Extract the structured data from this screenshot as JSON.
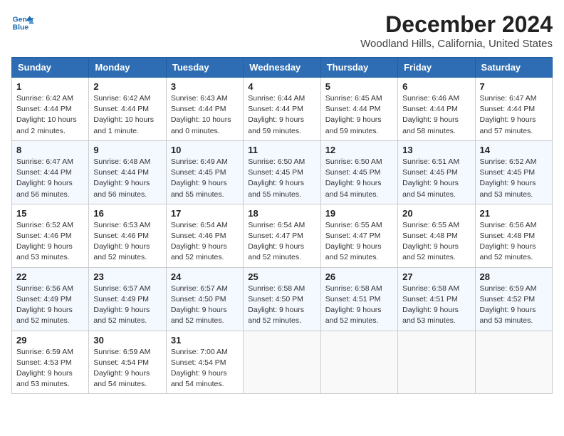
{
  "logo": {
    "line1": "General",
    "line2": "Blue"
  },
  "title": "December 2024",
  "subtitle": "Woodland Hills, California, United States",
  "days_of_week": [
    "Sunday",
    "Monday",
    "Tuesday",
    "Wednesday",
    "Thursday",
    "Friday",
    "Saturday"
  ],
  "weeks": [
    [
      {
        "day": "1",
        "sunrise": "6:42 AM",
        "sunset": "4:44 PM",
        "daylight": "10 hours and 2 minutes."
      },
      {
        "day": "2",
        "sunrise": "6:42 AM",
        "sunset": "4:44 PM",
        "daylight": "10 hours and 1 minute."
      },
      {
        "day": "3",
        "sunrise": "6:43 AM",
        "sunset": "4:44 PM",
        "daylight": "10 hours and 0 minutes."
      },
      {
        "day": "4",
        "sunrise": "6:44 AM",
        "sunset": "4:44 PM",
        "daylight": "9 hours and 59 minutes."
      },
      {
        "day": "5",
        "sunrise": "6:45 AM",
        "sunset": "4:44 PM",
        "daylight": "9 hours and 59 minutes."
      },
      {
        "day": "6",
        "sunrise": "6:46 AM",
        "sunset": "4:44 PM",
        "daylight": "9 hours and 58 minutes."
      },
      {
        "day": "7",
        "sunrise": "6:47 AM",
        "sunset": "4:44 PM",
        "daylight": "9 hours and 57 minutes."
      }
    ],
    [
      {
        "day": "8",
        "sunrise": "6:47 AM",
        "sunset": "4:44 PM",
        "daylight": "9 hours and 56 minutes."
      },
      {
        "day": "9",
        "sunrise": "6:48 AM",
        "sunset": "4:44 PM",
        "daylight": "9 hours and 56 minutes."
      },
      {
        "day": "10",
        "sunrise": "6:49 AM",
        "sunset": "4:45 PM",
        "daylight": "9 hours and 55 minutes."
      },
      {
        "day": "11",
        "sunrise": "6:50 AM",
        "sunset": "4:45 PM",
        "daylight": "9 hours and 55 minutes."
      },
      {
        "day": "12",
        "sunrise": "6:50 AM",
        "sunset": "4:45 PM",
        "daylight": "9 hours and 54 minutes."
      },
      {
        "day": "13",
        "sunrise": "6:51 AM",
        "sunset": "4:45 PM",
        "daylight": "9 hours and 54 minutes."
      },
      {
        "day": "14",
        "sunrise": "6:52 AM",
        "sunset": "4:45 PM",
        "daylight": "9 hours and 53 minutes."
      }
    ],
    [
      {
        "day": "15",
        "sunrise": "6:52 AM",
        "sunset": "4:46 PM",
        "daylight": "9 hours and 53 minutes."
      },
      {
        "day": "16",
        "sunrise": "6:53 AM",
        "sunset": "4:46 PM",
        "daylight": "9 hours and 52 minutes."
      },
      {
        "day": "17",
        "sunrise": "6:54 AM",
        "sunset": "4:46 PM",
        "daylight": "9 hours and 52 minutes."
      },
      {
        "day": "18",
        "sunrise": "6:54 AM",
        "sunset": "4:47 PM",
        "daylight": "9 hours and 52 minutes."
      },
      {
        "day": "19",
        "sunrise": "6:55 AM",
        "sunset": "4:47 PM",
        "daylight": "9 hours and 52 minutes."
      },
      {
        "day": "20",
        "sunrise": "6:55 AM",
        "sunset": "4:48 PM",
        "daylight": "9 hours and 52 minutes."
      },
      {
        "day": "21",
        "sunrise": "6:56 AM",
        "sunset": "4:48 PM",
        "daylight": "9 hours and 52 minutes."
      }
    ],
    [
      {
        "day": "22",
        "sunrise": "6:56 AM",
        "sunset": "4:49 PM",
        "daylight": "9 hours and 52 minutes."
      },
      {
        "day": "23",
        "sunrise": "6:57 AM",
        "sunset": "4:49 PM",
        "daylight": "9 hours and 52 minutes."
      },
      {
        "day": "24",
        "sunrise": "6:57 AM",
        "sunset": "4:50 PM",
        "daylight": "9 hours and 52 minutes."
      },
      {
        "day": "25",
        "sunrise": "6:58 AM",
        "sunset": "4:50 PM",
        "daylight": "9 hours and 52 minutes."
      },
      {
        "day": "26",
        "sunrise": "6:58 AM",
        "sunset": "4:51 PM",
        "daylight": "9 hours and 52 minutes."
      },
      {
        "day": "27",
        "sunrise": "6:58 AM",
        "sunset": "4:51 PM",
        "daylight": "9 hours and 53 minutes."
      },
      {
        "day": "28",
        "sunrise": "6:59 AM",
        "sunset": "4:52 PM",
        "daylight": "9 hours and 53 minutes."
      }
    ],
    [
      {
        "day": "29",
        "sunrise": "6:59 AM",
        "sunset": "4:53 PM",
        "daylight": "9 hours and 53 minutes."
      },
      {
        "day": "30",
        "sunrise": "6:59 AM",
        "sunset": "4:54 PM",
        "daylight": "9 hours and 54 minutes."
      },
      {
        "day": "31",
        "sunrise": "7:00 AM",
        "sunset": "4:54 PM",
        "daylight": "9 hours and 54 minutes."
      },
      null,
      null,
      null,
      null
    ]
  ],
  "labels": {
    "sunrise": "Sunrise:",
    "sunset": "Sunset:",
    "daylight": "Daylight:"
  }
}
